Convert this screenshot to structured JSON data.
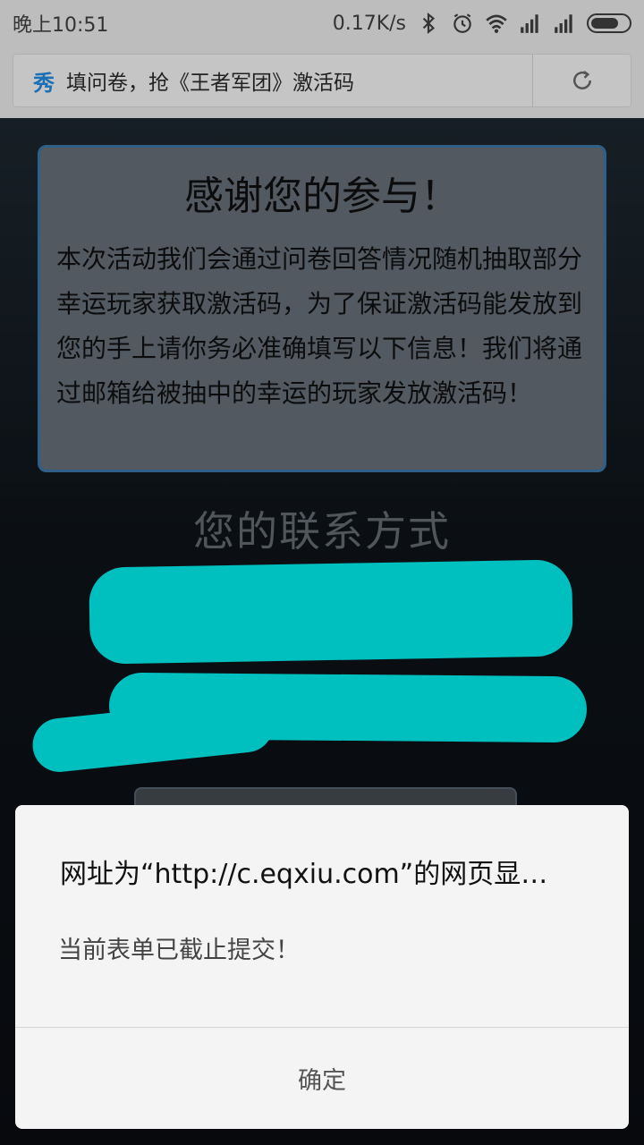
{
  "status_bar": {
    "time": "晚上10:51",
    "network_speed": "0.17K/s",
    "icons": [
      "bluetooth-icon",
      "alarm-icon",
      "wifi-icon",
      "signal-icon",
      "signal-icon",
      "battery-icon"
    ]
  },
  "browser": {
    "logo_text": "秀",
    "page_title": "填问卷，抢《王者军团》激活码",
    "reload_icon": "reload-icon"
  },
  "card": {
    "title": "感谢您的参与！",
    "body": "本次活动我们会通过问卷回答情况随机抽取部分幸运玩家获取激活码，为了保证激活码能发放到您的手上请你务必准确填写以下信息！我们将通过邮箱给被抽中的幸运的玩家发放激活码！"
  },
  "contact_section": {
    "title": "您的联系方式"
  },
  "dialog": {
    "title": "网址为“http://c.eqxiu.com”的网页显…",
    "message": "当前表单已截止提交！",
    "ok_button": "确定"
  },
  "colors": {
    "redaction": "#00ffff",
    "card_border": "#3f7fb3",
    "dialog_bg": "#f4f4f4"
  }
}
